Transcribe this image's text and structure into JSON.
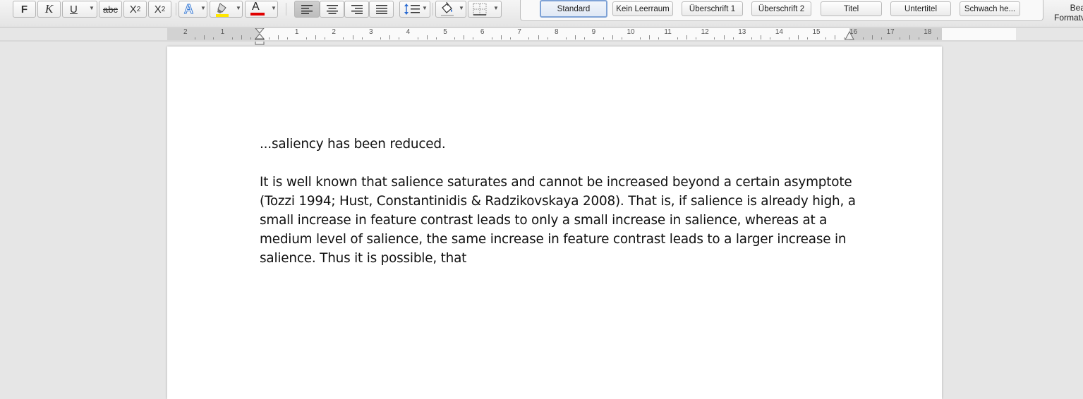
{
  "toolbar": {
    "bold_label": "F",
    "italic_label": "K",
    "underline_label": "U",
    "strike_label": "abc",
    "subscript_label": "X",
    "subscript_mark": "2",
    "superscript_label": "X",
    "superscript_mark": "2",
    "text_effects_label": "A",
    "font_color_label": "A",
    "highlight_color": "#ffe600",
    "font_color": "#e00000"
  },
  "styles": [
    {
      "label": "Standard"
    },
    {
      "label": "Kein Leerraum"
    },
    {
      "label": "Überschrift 1"
    },
    {
      "label": "Überschrift 2"
    },
    {
      "label": "Titel"
    },
    {
      "label": "Untertitel"
    },
    {
      "label": "Schwach he..."
    }
  ],
  "ribbon_right": {
    "line1": "Bea",
    "line2": "Formatv"
  },
  "ruler": {
    "labels": [
      "2",
      "1",
      "1",
      "2",
      "3",
      "4",
      "5",
      "6",
      "7",
      "8",
      "9",
      "10",
      "11",
      "12",
      "13",
      "14",
      "15",
      "16",
      "17",
      "18"
    ]
  },
  "document": {
    "para1": "...saliency has been reduced.",
    "para2_lines": [
      "It is well known that salience saturates and cannot be increased beyond a certain asymptote",
      "(Tozzi 1994; Hust, Constantinidis & Radzikovskaya 2008). That is, if salience is already high, a",
      "small increase in feature contrast leads to only a small increase in salience, whereas at a",
      "medium level of salience, the same increase in feature contrast leads to a larger increase in",
      "salience. Thus it is possible, that"
    ]
  }
}
